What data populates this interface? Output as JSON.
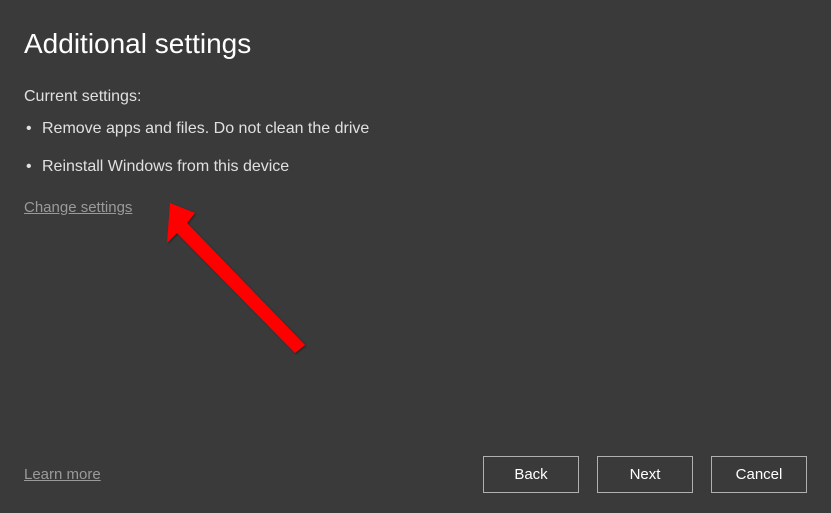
{
  "page": {
    "title": "Additional settings"
  },
  "current_settings": {
    "label": "Current settings:",
    "items": [
      "Remove apps and files. Do not clean the drive",
      "Reinstall Windows from this device"
    ]
  },
  "links": {
    "change_settings": "Change settings",
    "learn_more": "Learn more"
  },
  "buttons": {
    "back": "Back",
    "next": "Next",
    "cancel": "Cancel"
  }
}
